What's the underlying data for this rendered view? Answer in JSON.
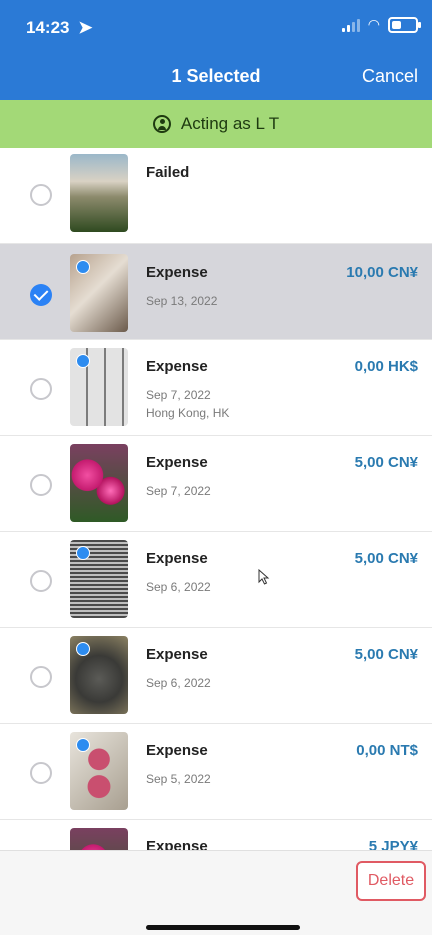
{
  "status_bar": {
    "time": "14:23"
  },
  "header": {
    "title": "1 Selected",
    "cancel_label": "Cancel"
  },
  "acting_banner": {
    "text": "Acting as L T"
  },
  "rows": [
    {
      "title": "Failed",
      "date": "",
      "location": "",
      "amount": "",
      "selected": false
    },
    {
      "title": "Expense",
      "date": "Sep 13, 2022",
      "location": "",
      "amount": "10,00 CN¥",
      "selected": true
    },
    {
      "title": "Expense",
      "date": "Sep 7, 2022",
      "location": "Hong Kong, HK",
      "amount": "0,00 HK$",
      "selected": false
    },
    {
      "title": "Expense",
      "date": "Sep 7, 2022",
      "location": "",
      "amount": "5,00 CN¥",
      "selected": false
    },
    {
      "title": "Expense",
      "date": "Sep 6, 2022",
      "location": "",
      "amount": "5,00 CN¥",
      "selected": false
    },
    {
      "title": "Expense",
      "date": "Sep 6, 2022",
      "location": "",
      "amount": "5,00 CN¥",
      "selected": false
    },
    {
      "title": "Expense",
      "date": "Sep 5, 2022",
      "location": "",
      "amount": "0,00 NT$",
      "selected": false
    },
    {
      "title": "Expense",
      "date": "",
      "location": "",
      "amount": "5 JPY¥",
      "selected": false
    }
  ],
  "bottom_bar": {
    "delete_label": "Delete"
  }
}
